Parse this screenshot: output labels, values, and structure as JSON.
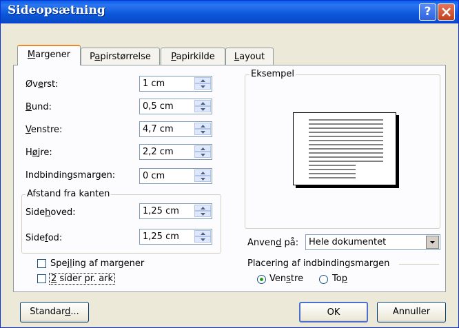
{
  "window": {
    "title": "Sideopsætning",
    "help_label": "?"
  },
  "tabs": [
    {
      "prefix": "",
      "ul": "M",
      "suffix": "argener"
    },
    {
      "prefix": "P",
      "ul": "a",
      "suffix": "pirstørrelse"
    },
    {
      "prefix": "",
      "ul": "P",
      "suffix": "apirkilde"
    },
    {
      "prefix": "",
      "ul": "L",
      "suffix": "ayout"
    }
  ],
  "margins": [
    {
      "pre": "Øv",
      "ul": "e",
      "post": "rst:",
      "value": "1 cm"
    },
    {
      "pre": "",
      "ul": "B",
      "post": "und:",
      "value": "0,5 cm"
    },
    {
      "pre": "",
      "ul": "V",
      "post": "enstre:",
      "value": "4,7 cm"
    },
    {
      "pre": "H",
      "ul": "ø",
      "post": "jre:",
      "value": "2,2 cm"
    },
    {
      "pre": "Indbindin",
      "ul": "g",
      "post": "smargen:",
      "value": "0 cm"
    }
  ],
  "afstand": {
    "title": "Afstand fra kanten",
    "header": {
      "pre": "Side",
      "ul": "h",
      "post": "oved:",
      "value": "1,25 cm"
    },
    "footer": {
      "pre": "Side",
      "ul": "f",
      "post": "od:",
      "value": "1,25 cm"
    }
  },
  "eksempel": {
    "title": "Eksempel"
  },
  "anvend": {
    "pre": "Anven",
    "ul": "d",
    "post": " på:",
    "value": "Hele dokumentet"
  },
  "gutter": {
    "title": "Placering af indbindingsmargen",
    "left": {
      "pre": "Ven",
      "ul": "s",
      "post": "tre"
    },
    "top": {
      "pre": "To",
      "ul": "p",
      "post": ""
    }
  },
  "checkboxes": {
    "mirror": {
      "pre": "Spej",
      "ul": "l",
      "post": "ing af margener"
    },
    "two_pages": {
      "pre": "",
      "ul": "2",
      "post": " sider pr. ark"
    }
  },
  "buttons": {
    "default": {
      "pre": "Standar",
      "ul": "d",
      "post": "..."
    },
    "ok": "OK",
    "cancel": "Annuller"
  }
}
